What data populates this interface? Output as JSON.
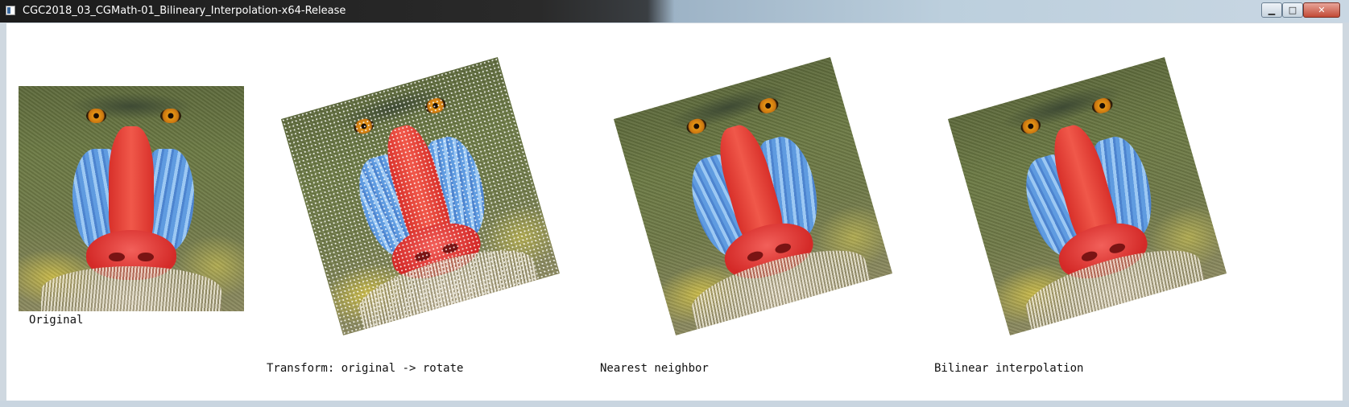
{
  "window": {
    "title": "CGC2018_03_CGMath-01_Bilineary_Interpolation-x64-Release",
    "minimize_glyph": "▁",
    "maximize_glyph": "□",
    "close_glyph": "✕"
  },
  "panels": {
    "original": {
      "caption": "Original"
    },
    "transform": {
      "caption": "Transform: original -> rotate"
    },
    "nearest": {
      "caption": "Nearest neighbor"
    },
    "bilinear": {
      "caption": "Bilinear interpolation"
    }
  }
}
